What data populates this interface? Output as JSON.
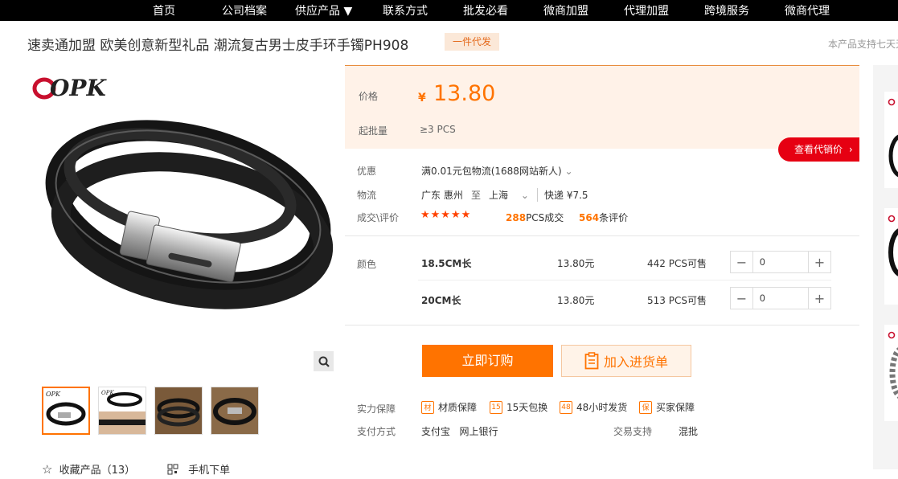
{
  "nav": {
    "items": [
      "首页",
      "公司档案",
      "供应产品 ▼",
      "联系方式",
      "批发必看",
      "微商加盟",
      "代理加盟",
      "跨境服务",
      "微商代理"
    ]
  },
  "product": {
    "title": "速卖通加盟 欧美创意新型礼品 潮流复古男士皮手环手镯PH908",
    "badge": "一件代发",
    "support_note": "本产品支持七天无",
    "brand": "OPK"
  },
  "price": {
    "label": "价格",
    "currency": "¥",
    "value": "13.80",
    "moq_label": "起批量",
    "moq_value": "≥3  PCS"
  },
  "agent_button": "查看代销价",
  "promo": {
    "label": "优惠",
    "text": "满0.01元包物流(1688网站新人)"
  },
  "logistics": {
    "label": "物流",
    "from": "广东 惠州",
    "to_word": "至",
    "to": "上海",
    "method": "快递 ¥7.5"
  },
  "deals": {
    "label": "成交\\评价",
    "stars": "★★★★★",
    "sold_num": "288",
    "sold_suffix": "PCS成交",
    "review_num": "564",
    "review_suffix": "条评价"
  },
  "sku": {
    "label": "颜色",
    "rows": [
      {
        "name": "18.5CM长",
        "price": "13.80元",
        "stock": "442 PCS可售",
        "qty": "0"
      },
      {
        "name": "20CM长",
        "price": "13.80元",
        "stock": "513 PCS可售",
        "qty": "0"
      }
    ]
  },
  "actions": {
    "buy": "立即订购",
    "cart": "加入进货单"
  },
  "guarantee": {
    "label": "实力保障",
    "items": [
      {
        "icon": "材",
        "text": "材质保障"
      },
      {
        "icon": "15",
        "text": "15天包换"
      },
      {
        "icon": "48",
        "text": "48小时发货"
      },
      {
        "icon": "保",
        "text": "买家保障"
      }
    ]
  },
  "payment": {
    "label": "支付方式",
    "methods": "支付宝   网上银行",
    "trade_label": "交易支持",
    "trade_value": "混批"
  },
  "footer": {
    "favorite": "收藏产品（13）",
    "mobile": "手机下单"
  },
  "colors": {
    "accent": "#ff7300",
    "agent_red": "#e60012",
    "price_bg": "#fff2e8"
  }
}
